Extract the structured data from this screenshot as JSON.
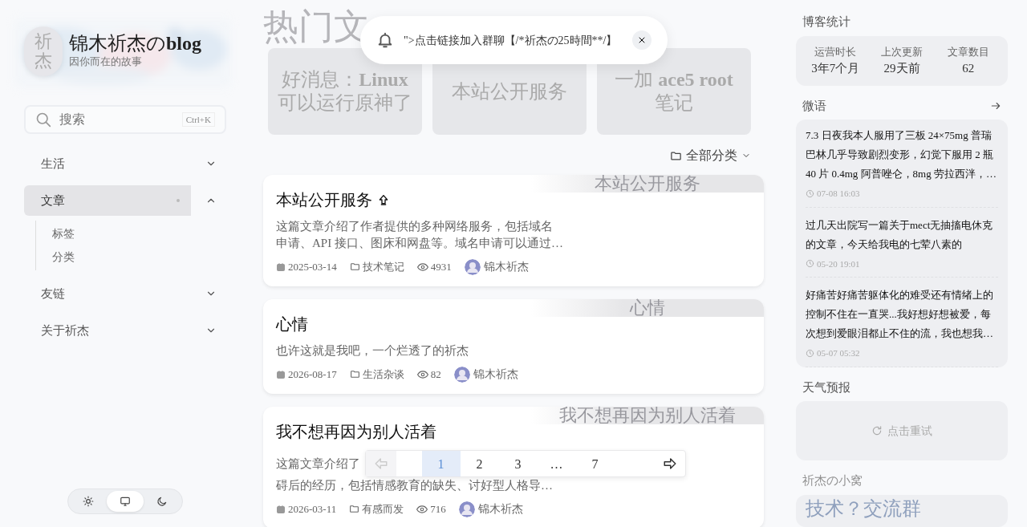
{
  "site": {
    "avatar_text": "祈杰",
    "title": "锦木祈杰の**blog**",
    "subtitle": "因你而在的故事"
  },
  "search": {
    "placeholder": "搜索",
    "shortcut": "Ctrl+K"
  },
  "nav": [
    {
      "label": "生活",
      "expanded": false,
      "selected": false
    },
    {
      "label": "文章",
      "expanded": true,
      "selected": true,
      "children": [
        {
          "label": "标签"
        },
        {
          "label": "分类"
        }
      ]
    },
    {
      "label": "友链",
      "expanded": false,
      "selected": false
    },
    {
      "label": "关于祈杰",
      "expanded": false,
      "selected": false
    }
  ],
  "theme_switch": [
    {
      "kind": "light",
      "selected": false
    },
    {
      "kind": "system",
      "selected": true
    },
    {
      "kind": "dark",
      "selected": false
    }
  ],
  "hot": {
    "heading": "热门文",
    "tiles": [
      {
        "title": "好消息：**Linux** 可以运行原神了"
      },
      {
        "title": "本站公开服务"
      },
      {
        "title": "一加 **ace5 root** 笔记"
      }
    ]
  },
  "toast": {
    "text": "\">点击链接加入群聊【/*祈杰の25時間**/】"
  },
  "filter": {
    "label": "全部分类"
  },
  "posts": [
    {
      "title": "本站公开服务",
      "pinned": true,
      "cover_title": "本站公开服务",
      "summary": [
        "这篇文章介绍了作者提供的多种网络服务，包括域名",
        "申请、API 接口、图床和网盘等。域名申请可以通过…"
      ],
      "date": "2025-03-14",
      "category": "技术笔记",
      "views": "4931",
      "author": "锦木祈杰"
    },
    {
      "title": "心情",
      "pinned": false,
      "cover_title": "心情",
      "summary": [
        "也许这就是我吧，一个烂透了的祈杰"
      ],
      "date": "2026-08-17",
      "category": "生活杂谈",
      "views": "82",
      "author": "锦木祈杰"
    },
    {
      "title": "我不想再因为别人活着",
      "pinned": false,
      "cover_title": "我不想再因为别人活着",
      "summary": [
        "这篇文章介绍了",
        "碍后的经历，包括情感教育的缺失、讨好型人格导…"
      ],
      "date": "2026-03-11",
      "category": "有感而发",
      "views": "716",
      "author": "锦木祈杰"
    }
  ],
  "pagination": {
    "prev_disabled": true,
    "pages": [
      {
        "label": "1",
        "selected": true
      },
      {
        "label": "2",
        "selected": false
      },
      {
        "label": "3",
        "selected": false
      },
      {
        "label": "…",
        "selected": false
      },
      {
        "label": "7",
        "selected": false
      }
    ]
  },
  "stats": {
    "heading": "博客统计",
    "items": [
      {
        "label": "运营时长",
        "value": "3年7个月"
      },
      {
        "label": "上次更新",
        "value": "29天前"
      },
      {
        "label": "文章数目",
        "value": "62"
      }
    ]
  },
  "moments": {
    "heading": "微语",
    "items": [
      {
        "text": "7.3 日夜我本人服用了三板 24×75mg 普瑞巴林几乎导致剧烈变形，幻觉下服用 2 瓶 40 片 0.4mg 阿普唑仑，8mg 劳拉西泮，…",
        "time": "07-08 16:03"
      },
      {
        "text": "过几天出院写一篇关于mect无抽搐电休克的文章，今天给我电的七荤八素的",
        "time": "05-20 19:01"
      },
      {
        "text": "好痛苦好痛苦躯体化的难受还有情绪上的控制不住在一直哭...我好想好想被爱，每次想到爱眼泪都止不住的流，我也想我…",
        "time": "05-07 05:32"
      }
    ]
  },
  "weather": {
    "heading": "天气预报",
    "retry": "点击重试"
  },
  "nest": {
    "heading": "祈杰の小窝",
    "text": "技术？交流群"
  }
}
